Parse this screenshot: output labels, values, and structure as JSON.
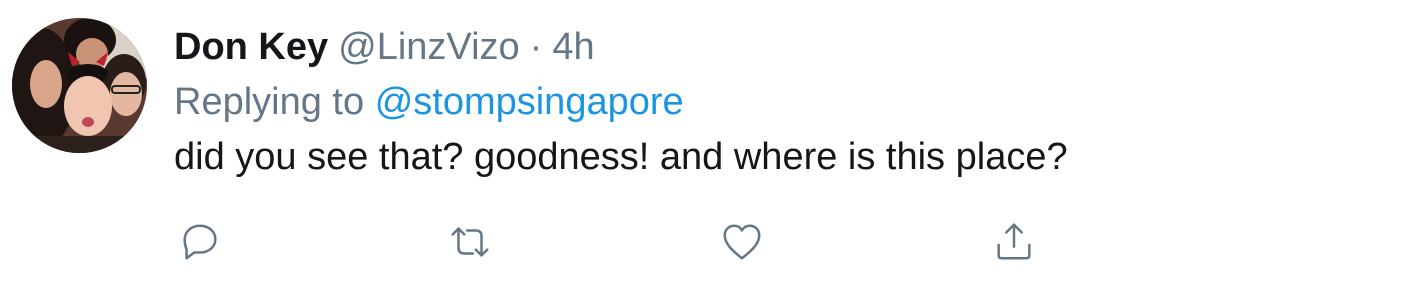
{
  "tweet": {
    "author_name": "Don Key",
    "author_handle": "@LinzVizo",
    "separator": "·",
    "timestamp": "4h",
    "replying_prefix": "Replying to",
    "replying_to": "@stompsingapore",
    "text": "did you see that? goodness! and where is this place?"
  },
  "actions": [
    {
      "icon": "reply-icon"
    },
    {
      "icon": "retweet-icon"
    },
    {
      "icon": "like-icon"
    },
    {
      "icon": "share-icon"
    }
  ],
  "colors": {
    "primary_text": "#14171a",
    "secondary_text": "#657786",
    "link": "#1b95e0",
    "background": "#ffffff"
  }
}
